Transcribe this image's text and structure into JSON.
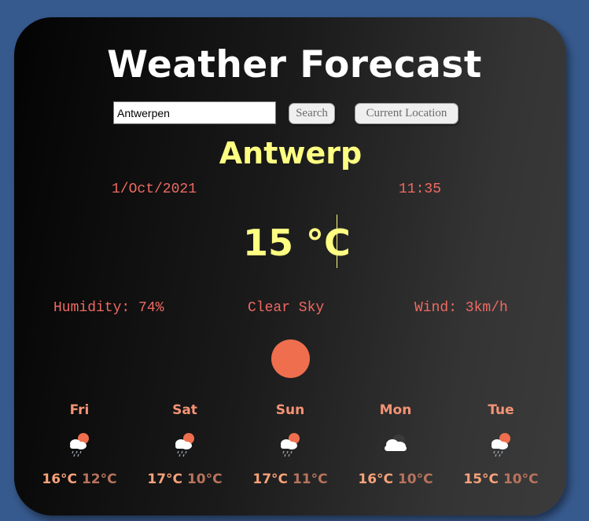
{
  "app": {
    "title": "Weather Forecast"
  },
  "search": {
    "value": "Antwerpen",
    "search_label": "Search",
    "location_label": "Current Location"
  },
  "current": {
    "city": "Antwerp",
    "date": "1/Oct/2021",
    "time": "11:35",
    "temperature": "15 °C",
    "humidity": "Humidity: 74%",
    "description": "Clear Sky",
    "wind": "Wind: 3km/h",
    "icon": "sun-icon",
    "icon_color": "#ef6e4e"
  },
  "forecast": [
    {
      "day": "Fri",
      "max": "16°C",
      "min": "12°C",
      "icon": "rain-cloud-sun-icon"
    },
    {
      "day": "Sat",
      "max": "17°C",
      "min": "10°C",
      "icon": "rain-cloud-sun-icon"
    },
    {
      "day": "Sun",
      "max": "17°C",
      "min": "11°C",
      "icon": "rain-cloud-sun-icon"
    },
    {
      "day": "Mon",
      "max": "16°C",
      "min": "10°C",
      "icon": "cloud-icon"
    },
    {
      "day": "Tue",
      "max": "15°C",
      "min": "10°C",
      "icon": "rain-cloud-sun-icon"
    }
  ],
  "colors": {
    "background": "#375a8e",
    "accent_yellow": "#fefe82",
    "accent_red": "#f06a63",
    "forecast_orange": "#f59375"
  }
}
